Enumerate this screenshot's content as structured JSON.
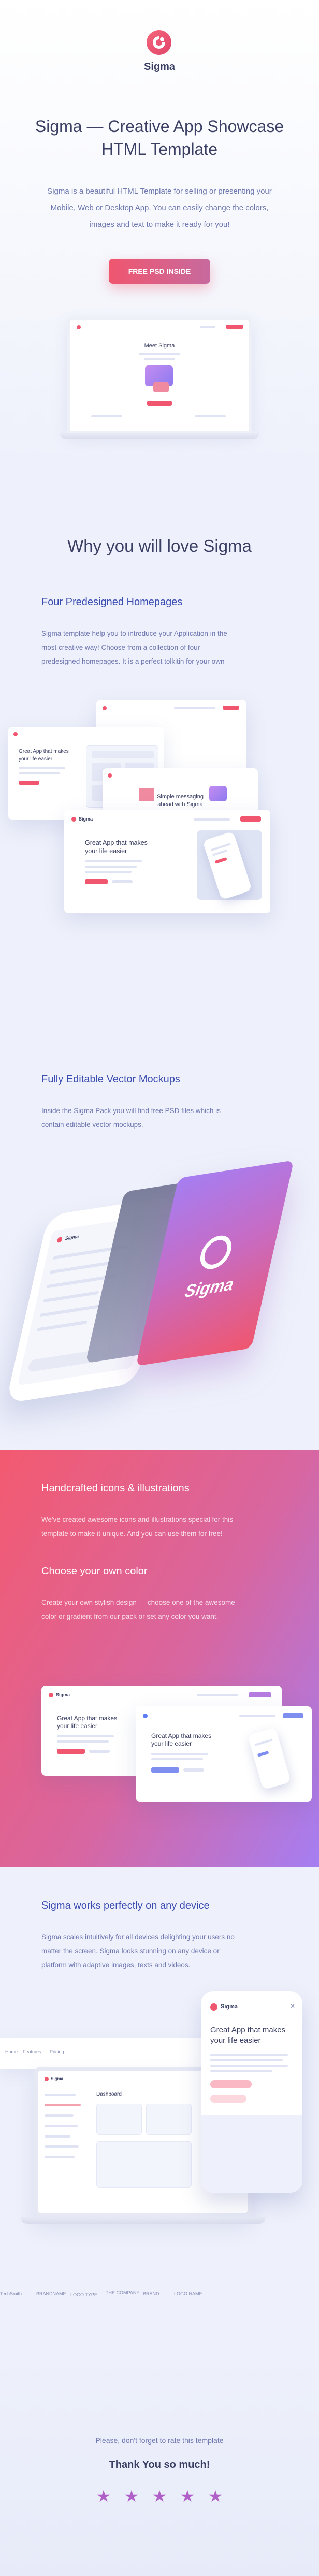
{
  "hero": {
    "brand": "Sigma",
    "title_line1": "Sigma — Creative App Showcase",
    "title_line2": "HTML Template",
    "desc_line1": "Sigma is a beautiful HTML Template for selling or presenting your",
    "desc_line2": "Mobile, Web or Desktop App. You can easily change the colors,",
    "desc_line3": "images and text to make it ready for you!",
    "cta_label": "FREE PSD INSIDE",
    "mock_heading": "Meet Sigma"
  },
  "love": {
    "title": "Why you will love Sigma"
  },
  "homepages": {
    "title": "Four Predesigned Homepages",
    "desc_line1": "Sigma template help you to introduce your Application in the",
    "desc_line2": "most creative way! Choose from a collection of four",
    "desc_line3": "predesigned homepages. It is a perfect tolkitin for your own",
    "card1_heading_l1": "Great App that makes",
    "card1_heading_l2": "your life easier",
    "card2_heading_l1": "Simple messaging",
    "card2_heading_l2": "ahead with Sigma",
    "card3_heading_l1": "Great App that makes",
    "card3_heading_l2": "your life easier",
    "card_brand": "Sigma"
  },
  "vector": {
    "title": "Fully Editable Vector Mockups",
    "desc_line1": "Inside the Sigma Pack you will find free PSD files which is",
    "desc_line2": "contain editable vector mockups.",
    "phone_brand": "Sigma",
    "screen_brand": "Sigma"
  },
  "icons": {
    "title": "Handcrafted icons & illustrations",
    "desc_line1": "We've created awesome icons and illustrations special for this",
    "desc_line2": "template to make it unique. And you can use them for free!"
  },
  "color": {
    "title": "Choose your own color",
    "desc_line1": "Create your own stylish design — choose one of the awesome",
    "desc_line2": "color or gradient from our pack or set any color you want.",
    "mock_heading_l1": "Great App that makes",
    "mock_heading_l2": "your life easier",
    "mock_brand": "Sigma"
  },
  "devices": {
    "title": "Sigma works perfectly on any device",
    "desc_line1": "Sigma scales intuitively for all devices delighting your users no",
    "desc_line2": "matter the screen. Sigma looks stunning on any device or",
    "desc_line3": "platform with adaptive images, texts and videos.",
    "dashboard_label": "Dashboard",
    "mobile_brand": "Sigma",
    "mobile_heading_l1": "Great App that makes",
    "mobile_heading_l2": "your life easier",
    "app_brand": "Sigma",
    "nav_items": [
      "Home",
      "Features",
      "Pricing"
    ],
    "brands": [
      "TechSmith",
      "BRANDNAME",
      "LOGO TYPE",
      "THE COMPANY",
      "BRAND",
      "LOGO NAME"
    ]
  },
  "footer": {
    "ask": "Please, don't forget to rate this template",
    "thanks": "Thank You so much!",
    "rating": 5,
    "star_color": "#b05fc8"
  },
  "colors": {
    "accent": "#f0566e",
    "violet": "#a57ef2",
    "navy": "#3a3f63",
    "blue_heading": "#3a4cb0"
  }
}
